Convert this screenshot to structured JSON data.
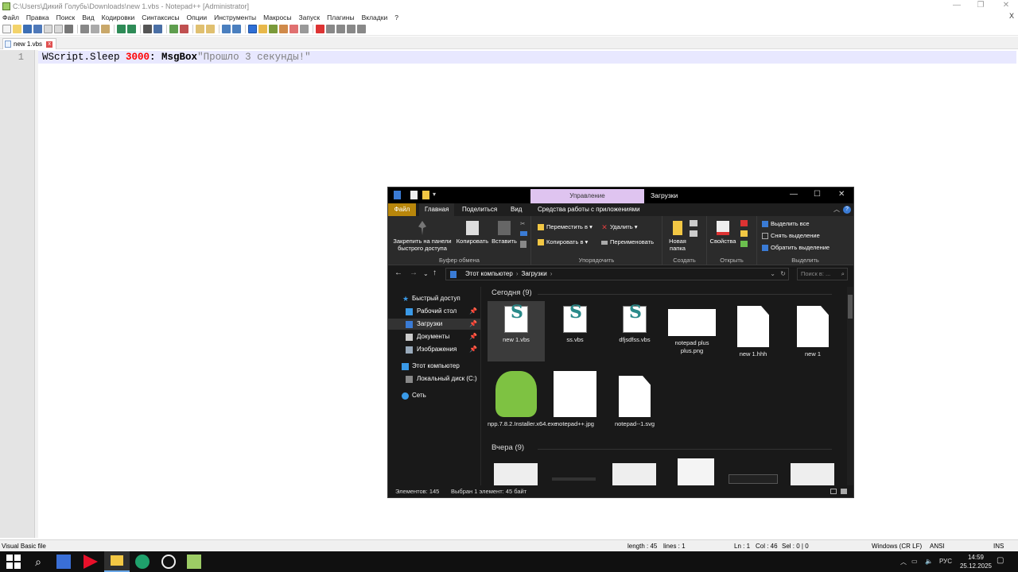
{
  "notepad": {
    "title": "C:\\Users\\Дикий Голубь\\Downloads\\new 1.vbs - Notepad++ [Administrator]",
    "menu": [
      "Файл",
      "Правка",
      "Поиск",
      "Вид",
      "Кодировки",
      "Синтаксисы",
      "Опции",
      "Инструменты",
      "Макросы",
      "Запуск",
      "Плагины",
      "Вкладки",
      "?"
    ],
    "menu_close": "X",
    "tab_label": "new 1.vbs",
    "tab_close": "x",
    "line_number": "1",
    "code": {
      "part1": "WScript.Sleep ",
      "number": "3000",
      "part2": ": MsgBox",
      "string": "\"Прошло 3 секунды!\""
    },
    "status": {
      "file_type": "Visual Basic file",
      "length": "length : 45",
      "lines": "lines : 1",
      "ln": "Ln : 1",
      "col": "Col : 46",
      "sel": "Sel : 0 | 0",
      "eol": "Windows (CR LF)",
      "encoding": "ANSI",
      "ins": "INS"
    }
  },
  "explorer": {
    "title": "Загрузки",
    "context_tab": "Управление",
    "ribbon_tabs": [
      "Файл",
      "Главная",
      "Поделиться",
      "Вид",
      "Средства работы с приложениями"
    ],
    "clipboard": {
      "pin": "Закрепить на панели быстрого доступа",
      "copy": "Копировать",
      "paste": "Вставить",
      "label": "Буфер обмена"
    },
    "organize": {
      "move": "Переместить в ▾",
      "copy_to": "Копировать в ▾",
      "delete": "Удалить ▾",
      "rename": "Переименовать",
      "label": "Упорядочить"
    },
    "create": {
      "new_folder": "Новая папка",
      "label": "Создать"
    },
    "open": {
      "properties": "Свойства",
      "label": "Открыть"
    },
    "select": {
      "all": "Выделить все",
      "none": "Снять выделение",
      "invert": "Обратить выделение",
      "label": "Выделить"
    },
    "breadcrumb": [
      "Этот компьютер",
      "Загрузки"
    ],
    "search_placeholder": "Поиск в: ...",
    "nav": {
      "quick_access": "Быстрый доступ",
      "desktop": "Рабочий стол",
      "downloads": "Загрузки",
      "documents": "Документы",
      "pictures": "Изображения",
      "this_pc": "Этот компьютер",
      "local_disk": "Локальный диск (C:)",
      "network": "Сеть"
    },
    "group_today": "Сегодня (9)",
    "group_yesterday": "Вчера (9)",
    "files": [
      {
        "name": "new 1.vbs"
      },
      {
        "name": "ss.vbs"
      },
      {
        "name": "dfjsdfss.vbs"
      },
      {
        "name": "notepad plus plus.png"
      },
      {
        "name": "new 1.hhh"
      },
      {
        "name": "new 1"
      },
      {
        "name": "npp.7.8.2.Installer.x64.exe"
      },
      {
        "name": "notepad++.jpg"
      },
      {
        "name": "notepad--1.svg"
      }
    ],
    "status_items": "Элементов: 145",
    "status_selected": "Выбран 1 элемент: 45 байт"
  },
  "taskbar": {
    "lang": "РУС",
    "time": "14:59",
    "date": "25.12.2025"
  },
  "colors": {
    "accent_file_tab": "#b8860b",
    "context_tab": "#dfc4f0",
    "code_number": "#ff0000",
    "code_string": "#808080"
  }
}
